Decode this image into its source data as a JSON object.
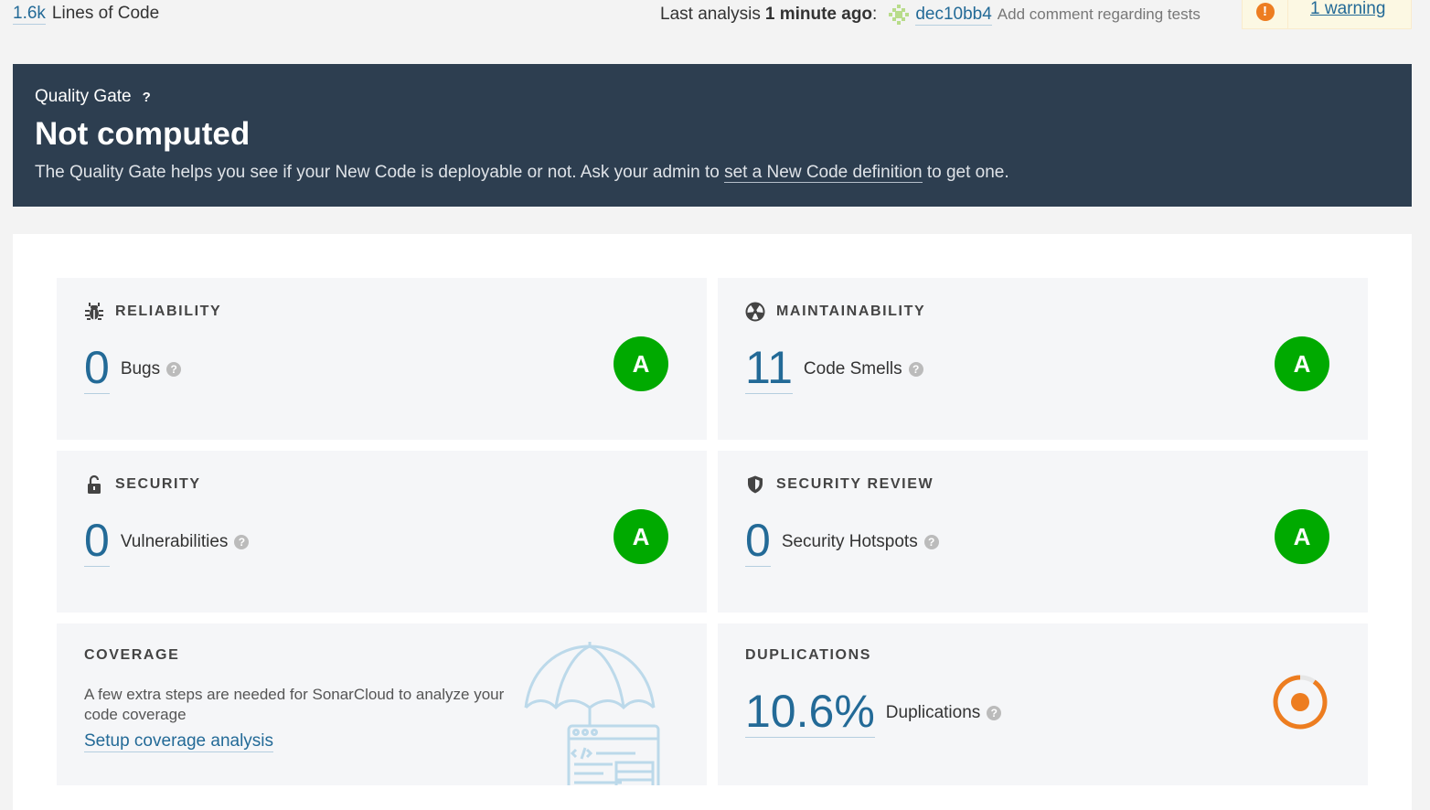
{
  "topbar": {
    "lines_value": "1.6k",
    "lines_label": "Lines of Code",
    "analysis_prefix": "Last analysis",
    "analysis_time": "1 minute ago",
    "analysis_colon": ":",
    "commit_hash": "dec10bb4",
    "commit_message": "Add comment regarding tests",
    "warning_icon": "!",
    "warning_link": "1 warning"
  },
  "quality_gate": {
    "label": "Quality Gate",
    "help": "?",
    "status": "Not computed",
    "desc_before": "The Quality Gate helps you see if your New Code is deployable or not. Ask your admin to ",
    "desc_link": "set a New Code definition",
    "desc_after": " to get one."
  },
  "cards": {
    "reliability": {
      "title": "RELIABILITY",
      "value": "0",
      "label": "Bugs",
      "rating": "A",
      "icon": "bug-icon"
    },
    "maintainability": {
      "title": "MAINTAINABILITY",
      "value": "11",
      "label": "Code Smells",
      "rating": "A",
      "icon": "radioactive-icon"
    },
    "security": {
      "title": "SECURITY",
      "value": "0",
      "label": "Vulnerabilities",
      "rating": "A",
      "icon": "lock-icon"
    },
    "security_review": {
      "title": "SECURITY REVIEW",
      "value": "0",
      "label": "Security Hotspots",
      "rating": "A",
      "icon": "shield-icon"
    },
    "coverage": {
      "title": "COVERAGE",
      "text": "A few extra steps are needed for SonarCloud to analyze your code coverage",
      "link": "Setup coverage analysis",
      "illustration": "umbrella-code-icon"
    },
    "duplications": {
      "title": "DUPLICATIONS",
      "value": "10.6%",
      "label": "Duplications",
      "donut_fraction": 0.106,
      "icon": "donut-chart-icon"
    }
  },
  "help_glyph": "?",
  "colors": {
    "accent": "#236a97",
    "gate_bg": "#2d3e50",
    "rating_a": "#00aa00",
    "duplication": "#ed7d20"
  }
}
